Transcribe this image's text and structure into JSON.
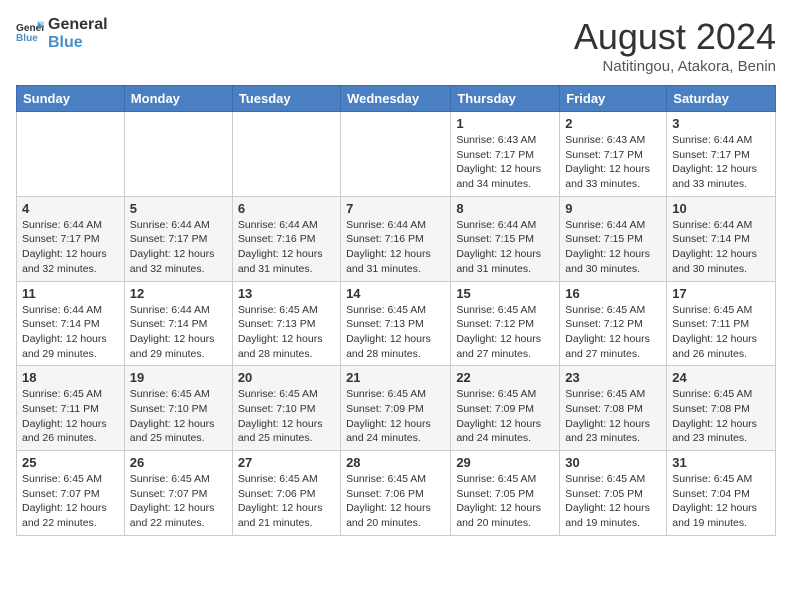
{
  "logo": {
    "line1": "General",
    "line2": "Blue"
  },
  "title": "August 2024",
  "location": "Natitingou, Atakora, Benin",
  "headers": [
    "Sunday",
    "Monday",
    "Tuesday",
    "Wednesday",
    "Thursday",
    "Friday",
    "Saturday"
  ],
  "weeks": [
    [
      {
        "day": "",
        "info": ""
      },
      {
        "day": "",
        "info": ""
      },
      {
        "day": "",
        "info": ""
      },
      {
        "day": "",
        "info": ""
      },
      {
        "day": "1",
        "info": "Sunrise: 6:43 AM\nSunset: 7:17 PM\nDaylight: 12 hours\nand 34 minutes."
      },
      {
        "day": "2",
        "info": "Sunrise: 6:43 AM\nSunset: 7:17 PM\nDaylight: 12 hours\nand 33 minutes."
      },
      {
        "day": "3",
        "info": "Sunrise: 6:44 AM\nSunset: 7:17 PM\nDaylight: 12 hours\nand 33 minutes."
      }
    ],
    [
      {
        "day": "4",
        "info": "Sunrise: 6:44 AM\nSunset: 7:17 PM\nDaylight: 12 hours\nand 32 minutes."
      },
      {
        "day": "5",
        "info": "Sunrise: 6:44 AM\nSunset: 7:17 PM\nDaylight: 12 hours\nand 32 minutes."
      },
      {
        "day": "6",
        "info": "Sunrise: 6:44 AM\nSunset: 7:16 PM\nDaylight: 12 hours\nand 31 minutes."
      },
      {
        "day": "7",
        "info": "Sunrise: 6:44 AM\nSunset: 7:16 PM\nDaylight: 12 hours\nand 31 minutes."
      },
      {
        "day": "8",
        "info": "Sunrise: 6:44 AM\nSunset: 7:15 PM\nDaylight: 12 hours\nand 31 minutes."
      },
      {
        "day": "9",
        "info": "Sunrise: 6:44 AM\nSunset: 7:15 PM\nDaylight: 12 hours\nand 30 minutes."
      },
      {
        "day": "10",
        "info": "Sunrise: 6:44 AM\nSunset: 7:14 PM\nDaylight: 12 hours\nand 30 minutes."
      }
    ],
    [
      {
        "day": "11",
        "info": "Sunrise: 6:44 AM\nSunset: 7:14 PM\nDaylight: 12 hours\nand 29 minutes."
      },
      {
        "day": "12",
        "info": "Sunrise: 6:44 AM\nSunset: 7:14 PM\nDaylight: 12 hours\nand 29 minutes."
      },
      {
        "day": "13",
        "info": "Sunrise: 6:45 AM\nSunset: 7:13 PM\nDaylight: 12 hours\nand 28 minutes."
      },
      {
        "day": "14",
        "info": "Sunrise: 6:45 AM\nSunset: 7:13 PM\nDaylight: 12 hours\nand 28 minutes."
      },
      {
        "day": "15",
        "info": "Sunrise: 6:45 AM\nSunset: 7:12 PM\nDaylight: 12 hours\nand 27 minutes."
      },
      {
        "day": "16",
        "info": "Sunrise: 6:45 AM\nSunset: 7:12 PM\nDaylight: 12 hours\nand 27 minutes."
      },
      {
        "day": "17",
        "info": "Sunrise: 6:45 AM\nSunset: 7:11 PM\nDaylight: 12 hours\nand 26 minutes."
      }
    ],
    [
      {
        "day": "18",
        "info": "Sunrise: 6:45 AM\nSunset: 7:11 PM\nDaylight: 12 hours\nand 26 minutes."
      },
      {
        "day": "19",
        "info": "Sunrise: 6:45 AM\nSunset: 7:10 PM\nDaylight: 12 hours\nand 25 minutes."
      },
      {
        "day": "20",
        "info": "Sunrise: 6:45 AM\nSunset: 7:10 PM\nDaylight: 12 hours\nand 25 minutes."
      },
      {
        "day": "21",
        "info": "Sunrise: 6:45 AM\nSunset: 7:09 PM\nDaylight: 12 hours\nand 24 minutes."
      },
      {
        "day": "22",
        "info": "Sunrise: 6:45 AM\nSunset: 7:09 PM\nDaylight: 12 hours\nand 24 minutes."
      },
      {
        "day": "23",
        "info": "Sunrise: 6:45 AM\nSunset: 7:08 PM\nDaylight: 12 hours\nand 23 minutes."
      },
      {
        "day": "24",
        "info": "Sunrise: 6:45 AM\nSunset: 7:08 PM\nDaylight: 12 hours\nand 23 minutes."
      }
    ],
    [
      {
        "day": "25",
        "info": "Sunrise: 6:45 AM\nSunset: 7:07 PM\nDaylight: 12 hours\nand 22 minutes."
      },
      {
        "day": "26",
        "info": "Sunrise: 6:45 AM\nSunset: 7:07 PM\nDaylight: 12 hours\nand 22 minutes."
      },
      {
        "day": "27",
        "info": "Sunrise: 6:45 AM\nSunset: 7:06 PM\nDaylight: 12 hours\nand 21 minutes."
      },
      {
        "day": "28",
        "info": "Sunrise: 6:45 AM\nSunset: 7:06 PM\nDaylight: 12 hours\nand 20 minutes."
      },
      {
        "day": "29",
        "info": "Sunrise: 6:45 AM\nSunset: 7:05 PM\nDaylight: 12 hours\nand 20 minutes."
      },
      {
        "day": "30",
        "info": "Sunrise: 6:45 AM\nSunset: 7:05 PM\nDaylight: 12 hours\nand 19 minutes."
      },
      {
        "day": "31",
        "info": "Sunrise: 6:45 AM\nSunset: 7:04 PM\nDaylight: 12 hours\nand 19 minutes."
      }
    ]
  ]
}
